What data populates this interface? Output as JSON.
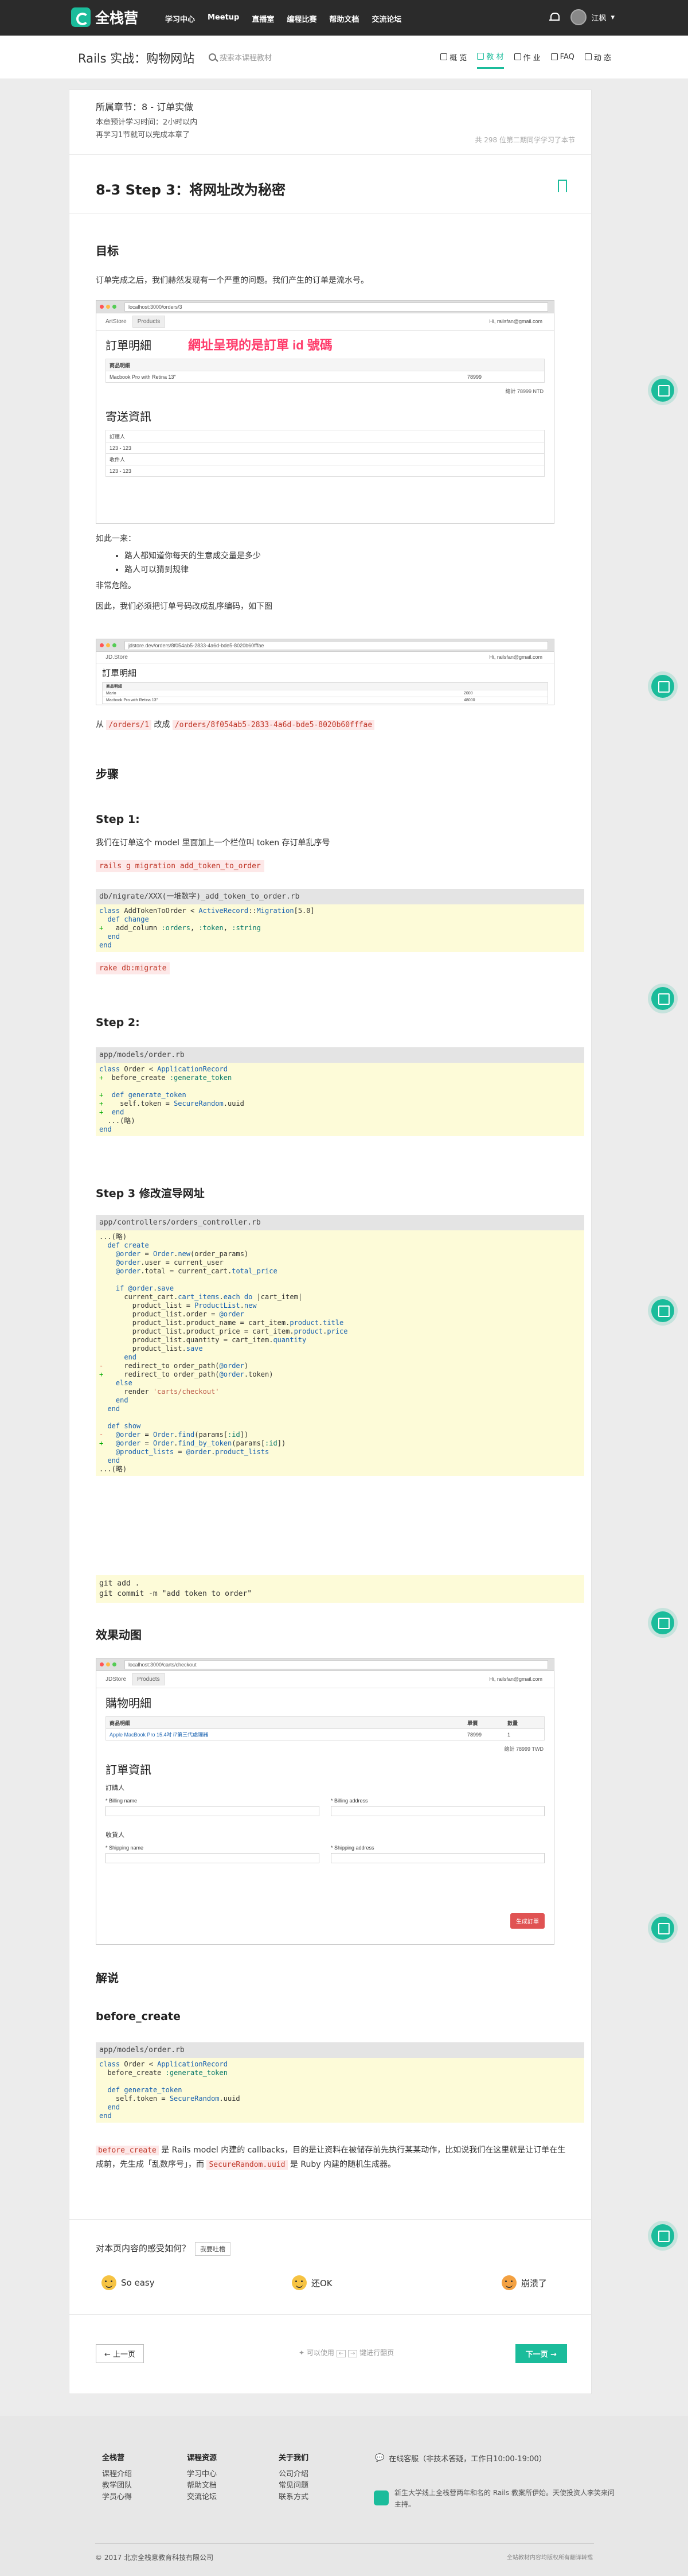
{
  "brand": "全栈营",
  "nav": [
    "学习中心",
    "Meetup",
    "直播室",
    "编程比赛",
    "帮助文档",
    "交流论坛"
  ],
  "user": "江枫",
  "course": "Rails 实战：购物网站",
  "search_placeholder": "搜索本课程教材",
  "tabs": [
    "概 览",
    "教 材",
    "作 业",
    "FAQ",
    "动 态"
  ],
  "section": "所属章节：8 - 订单实做",
  "progress_lines": [
    "本章预计学习时间：2小时以内",
    "再学习1节就可以完成本章了"
  ],
  "hint": "共 298 位第二期同学学习了本节",
  "title": "8-3 Step 3：将网址改为秘密",
  "goal_heading": "目标",
  "goal_text": "订单完成之后，我们赫然发现有一个严重的问题。我们产生的订单是流水号。",
  "shot1": {
    "url": "localhost:3000/orders/3",
    "brand": "ArtStore",
    "tab": "Products",
    "user": "Hi, railsfan@gmail.com",
    "title": "訂單明細",
    "annotation": "網址呈現的是訂單 id 號碼",
    "rows": [
      "商品明細",
      "Macbook Pro with Retina 13\""
    ],
    "row_price": "78999",
    "total": "總計 78999 NTD",
    "ship_title": "寄送資訊",
    "ship_rows": [
      "訂購人",
      "123 - 123",
      "收件人",
      "123 - 123"
    ]
  },
  "text_after1": "如此一来：",
  "bullets": [
    "路人都知道你每天的生意成交量是多少",
    "路人可以猜到规律"
  ],
  "text_danger": "非常危险。",
  "text_change": "因此，我们必须把订单号码改成乱序编码，如下图",
  "shot2": {
    "url": "jdstore.dev/orders/8f054ab5-2833-4a6d-bde5-8020b60fffae",
    "brand": "JD.Store",
    "user": "Hi, railsfan@gmail.com",
    "title": "訂單明細",
    "rows": [
      "商品明細",
      "Mario",
      "Macbook Pro with Retina 13\""
    ],
    "prices": [
      "",
      "2000",
      "48000"
    ]
  },
  "from_label": "从",
  "from_path": "/orders/1",
  "to_label": "改成",
  "to_path": "/orders/8f054ab5-2833-4a6d-bde5-8020b60fffae",
  "steps_heading": "步骤",
  "step1": "Step 1:",
  "step1_text": "我们在订单这个 model 里面加上一个栏位叫 token 存订单乱序号",
  "cmd1": "rails g migration add_token_to_order",
  "code1_file": "db/migrate/XXX(一堆数字)_add_token_to_order.rb",
  "cmd2": "rake db:migrate",
  "step2": "Step 2:",
  "code2_file": "app/models/order.rb",
  "step3": "Step 3 修改渲导网址",
  "code3_file": "app/controllers/orders_controller.rb",
  "git1": "git add .",
  "git2": "git commit -m \"add token to order\"",
  "anim_heading": "效果动图",
  "shot3": {
    "url": "localhost:3000/carts/checkout",
    "brand": "JDStore",
    "tab": "Products",
    "user": "Hi, railsfan@gmail.com",
    "title": "購物明細",
    "cols": [
      "商品明細",
      "單價",
      "數量"
    ],
    "item": "Apple MacBook Pro 15.4吋 i7第三代處理器",
    "price": "78999",
    "qty": "1",
    "total": "總計 78999 TWD",
    "info_title": "訂單資訊",
    "buyer": "訂購人",
    "billing_name": "* Billing name",
    "billing_address": "* Billing address",
    "receiver": "收貨人",
    "shipping_name": "* Shipping name",
    "shipping_address": "* Shipping address",
    "submit": "生成訂單"
  },
  "explain_heading": "解说",
  "before_heading": "before_create",
  "code4_file": "app/models/order.rb",
  "explain_p1a": "before_create",
  "explain_p1b": " 是 Rails model 内建的 callbacks，目的是让资料在被储存前先执行某某动作，比如说我们在这里就是让订单在生成前，先生成「乱数序号」，而 ",
  "explain_p1c": "SecureRandom.uuid",
  "explain_p1d": " 是 Ruby 内建的随机生成器。",
  "feedback_q": "对本页内容的感受如何？",
  "feedback_btn": "我要吐槽",
  "emotions": [
    "So easy",
    "还OK",
    "崩溃了"
  ],
  "prev": "← 上一页",
  "next": "下一页 →",
  "pager_hint_a": "可以使用",
  "pager_hint_b": "键进行翻页",
  "footer": {
    "col1": {
      "title": "全栈营",
      "items": [
        "课程介绍",
        "教学团队",
        "学员心得"
      ]
    },
    "col2": {
      "title": "课程资源",
      "items": [
        "学习中心",
        "帮助文档",
        "交流论坛"
      ]
    },
    "col3": {
      "title": "关于我们",
      "items": [
        "公司介绍",
        "常见问题",
        "联系方式"
      ]
    },
    "service": "在线客服（非技术答疑，工作日10:00-19:00）",
    "desc": "新生大学线上全栈营两年和名的 Rails 教案所伊始。天使投资人李笑来问主持。",
    "copyright": "© 2017 北京全栈意教育科技有限公司",
    "right": "全站教材内容均版权所有翻译转载"
  },
  "colors": {
    "accent": "#1bbc9b",
    "dark": "#2b2b2b",
    "pill": "#c0392b",
    "annotation": "#ff3b6b"
  }
}
